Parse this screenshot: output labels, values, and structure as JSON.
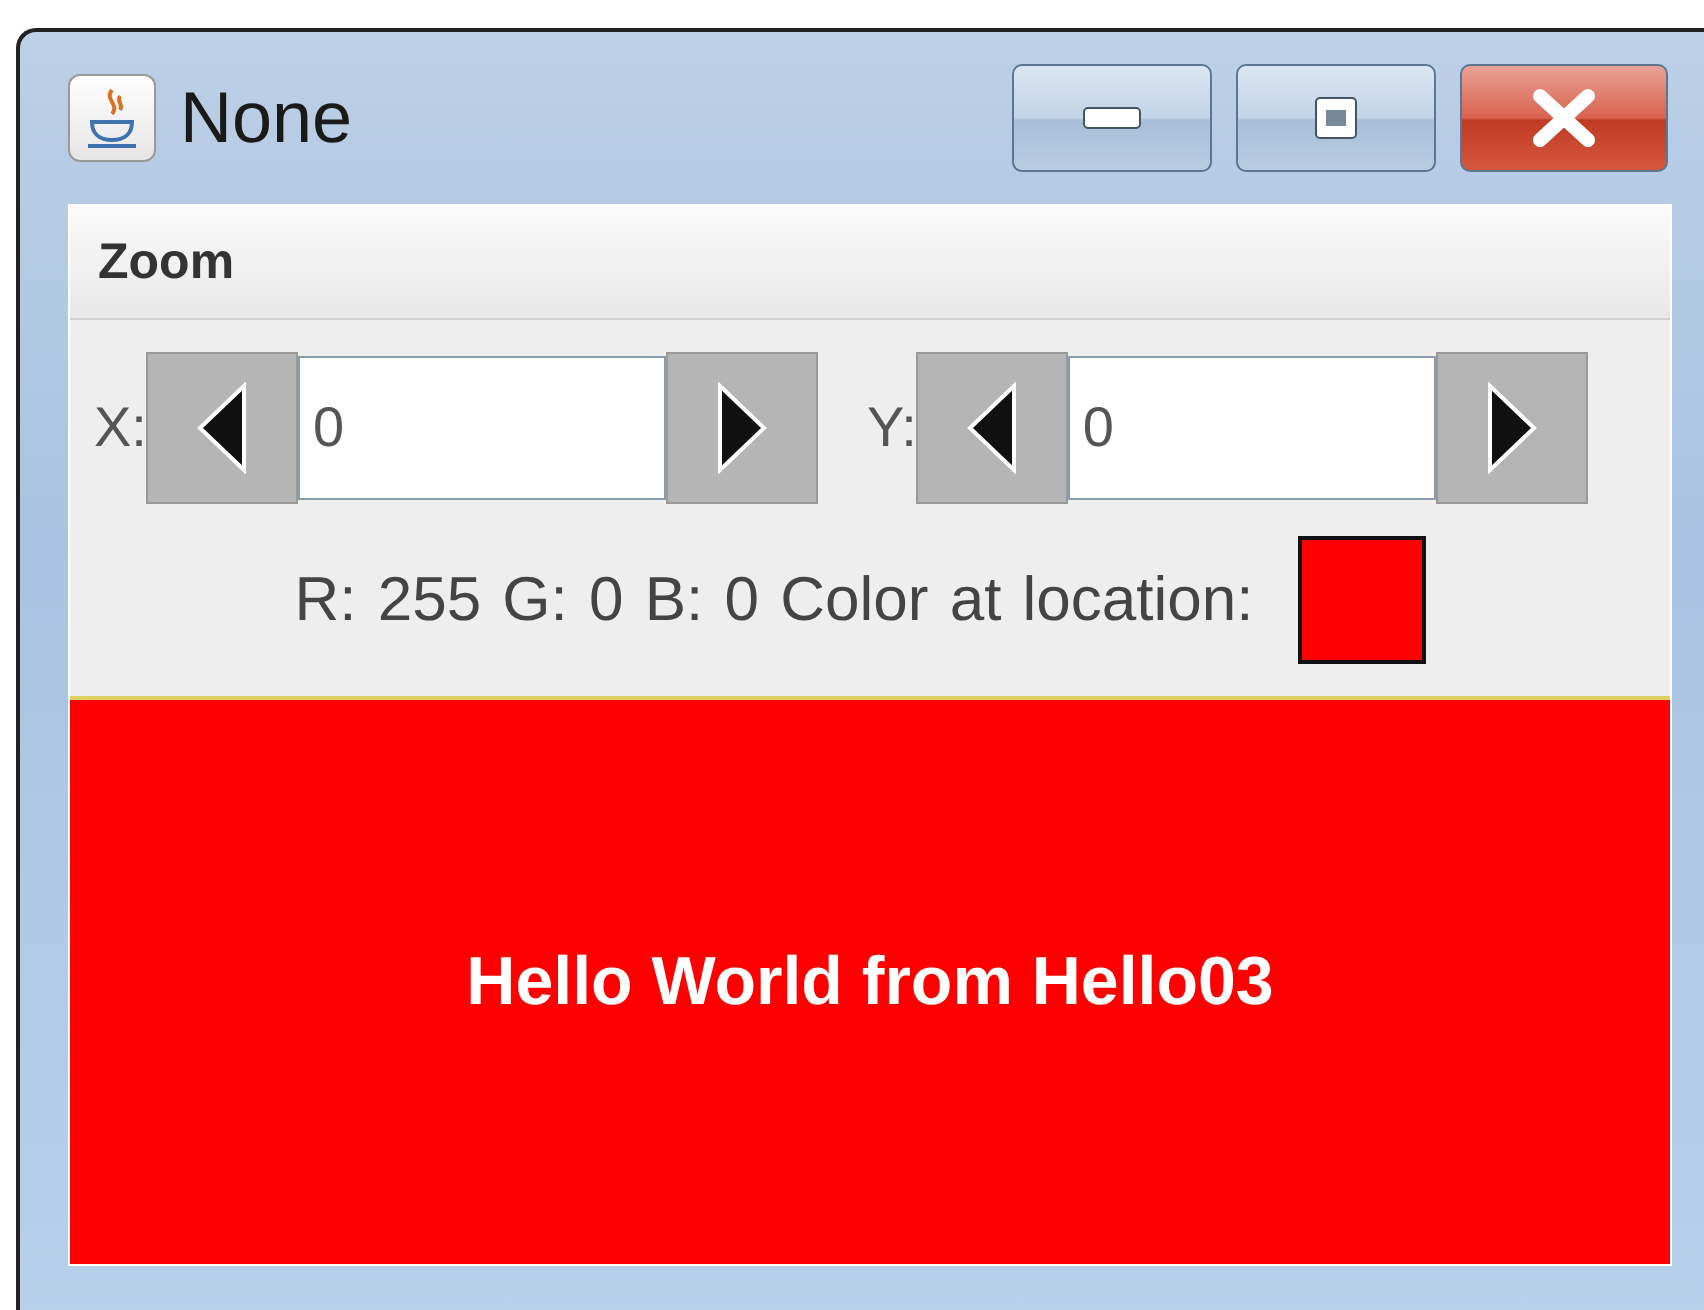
{
  "window": {
    "title": "None"
  },
  "menu_bar": [
    {
      "label": "Zoom"
    }
  ],
  "spinners": [
    {
      "label": "X:",
      "value": "0"
    },
    {
      "label": "Y:",
      "value": "0"
    }
  ],
  "color_readout": {
    "text": "R: 255 G: 0 B: 0 Color at location:",
    "color": "#ff0000"
  },
  "display": {
    "text": "Hello World from Hello03",
    "color": "#ff0000"
  }
}
